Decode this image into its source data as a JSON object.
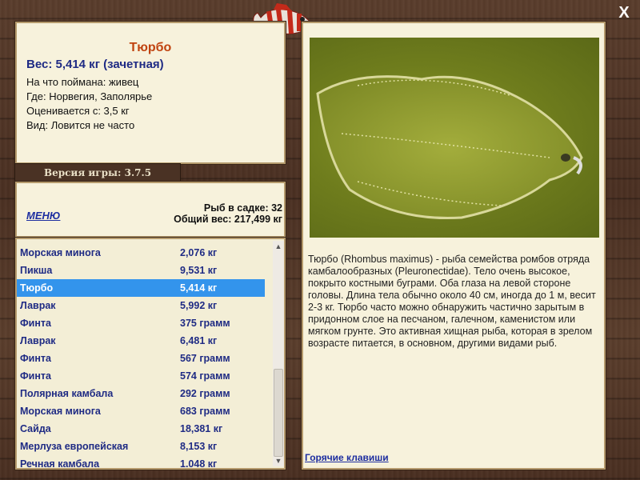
{
  "fish_card": {
    "title": "Тюрбо",
    "weight": "Вес: 5,414 кг (зачетная)",
    "lines": [
      "На что поймана: живец",
      "Где: Норвегия, Заполярье",
      "Оценивается с: 3,5 кг",
      "Вид: Ловится не часто"
    ]
  },
  "version": "Версия игры: 3.7.5",
  "catch": {
    "menu_label": "МЕНЮ",
    "fish_count": "Рыб в садке: 32",
    "total_weight": "Общий вес: 217,499 кг"
  },
  "fish_list": [
    {
      "name": "Морская минога",
      "weight": "2,076 кг"
    },
    {
      "name": "Пикша",
      "weight": "9,531 кг"
    },
    {
      "name": "Тюрбо",
      "weight": "5,414 кг",
      "selected": true
    },
    {
      "name": "Лаврак",
      "weight": "5,992 кг"
    },
    {
      "name": "Финта",
      "weight": "375 грамм"
    },
    {
      "name": "Лаврак",
      "weight": "6,481 кг"
    },
    {
      "name": "Финта",
      "weight": "567 грамм"
    },
    {
      "name": "Финта",
      "weight": "574 грамм"
    },
    {
      "name": "Полярная камбала",
      "weight": "292 грамм"
    },
    {
      "name": "Морская минога",
      "weight": "683 грамм"
    },
    {
      "name": "Сайда",
      "weight": "18,381 кг"
    },
    {
      "name": "Мерлуза европейская",
      "weight": "8,153 кг"
    },
    {
      "name": "Речная камбала",
      "weight": "1.048 кг"
    }
  ],
  "detail": {
    "description": "Тюрбо (Rhombus maximus) - рыба семейства ромбов отряда камбалообразных (Pleuronectidae). Тело очень высокое, покрыто костными буграми. Оба глаза на левой стороне головы. Длина тела обычно около 40 см, иногда до 1 м, весит 2-3 кг. Тюрбо часто можно обнаружить частично зарытым в придонном слое на песчаном, галечном, каменистом или мягком грунте. Это активная хищная рыба, которая в зрелом возрасте питается, в основном, другими видами рыб.",
    "hotkeys_label": "Горячие клавиши"
  },
  "window": {
    "close_label": "X"
  },
  "icons": {
    "logo": "red-striped-fish-logo",
    "close": "close-icon",
    "scroll_up": "arrow-up-icon",
    "scroll_down": "arrow-down-icon",
    "photo": "turbot-fish-photo"
  },
  "colors": {
    "accent_title": "#c0430f",
    "link_blue": "#1d2ea0",
    "selection": "#3394ec",
    "panel_bg": "#f7f2dc"
  }
}
